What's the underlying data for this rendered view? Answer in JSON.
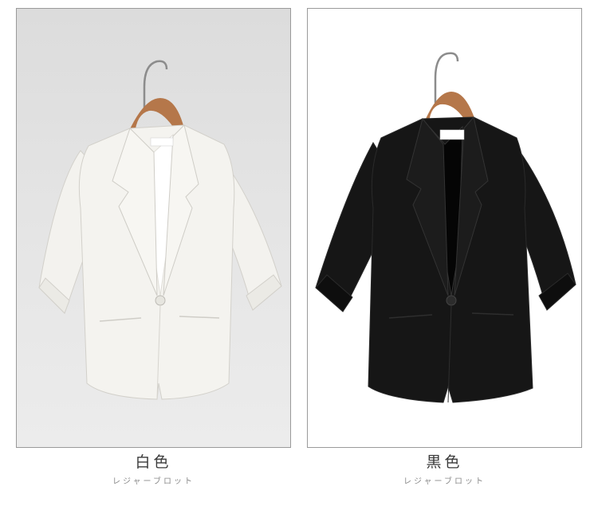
{
  "products": [
    {
      "color_name": "白色",
      "subtitle": "レジャーブロット",
      "jacket_color": "#f4f3ef",
      "background": "#e2e2e2"
    },
    {
      "color_name": "黒色",
      "subtitle": "レジャーブロット",
      "jacket_color": "#141414",
      "background": "#ffffff"
    }
  ]
}
